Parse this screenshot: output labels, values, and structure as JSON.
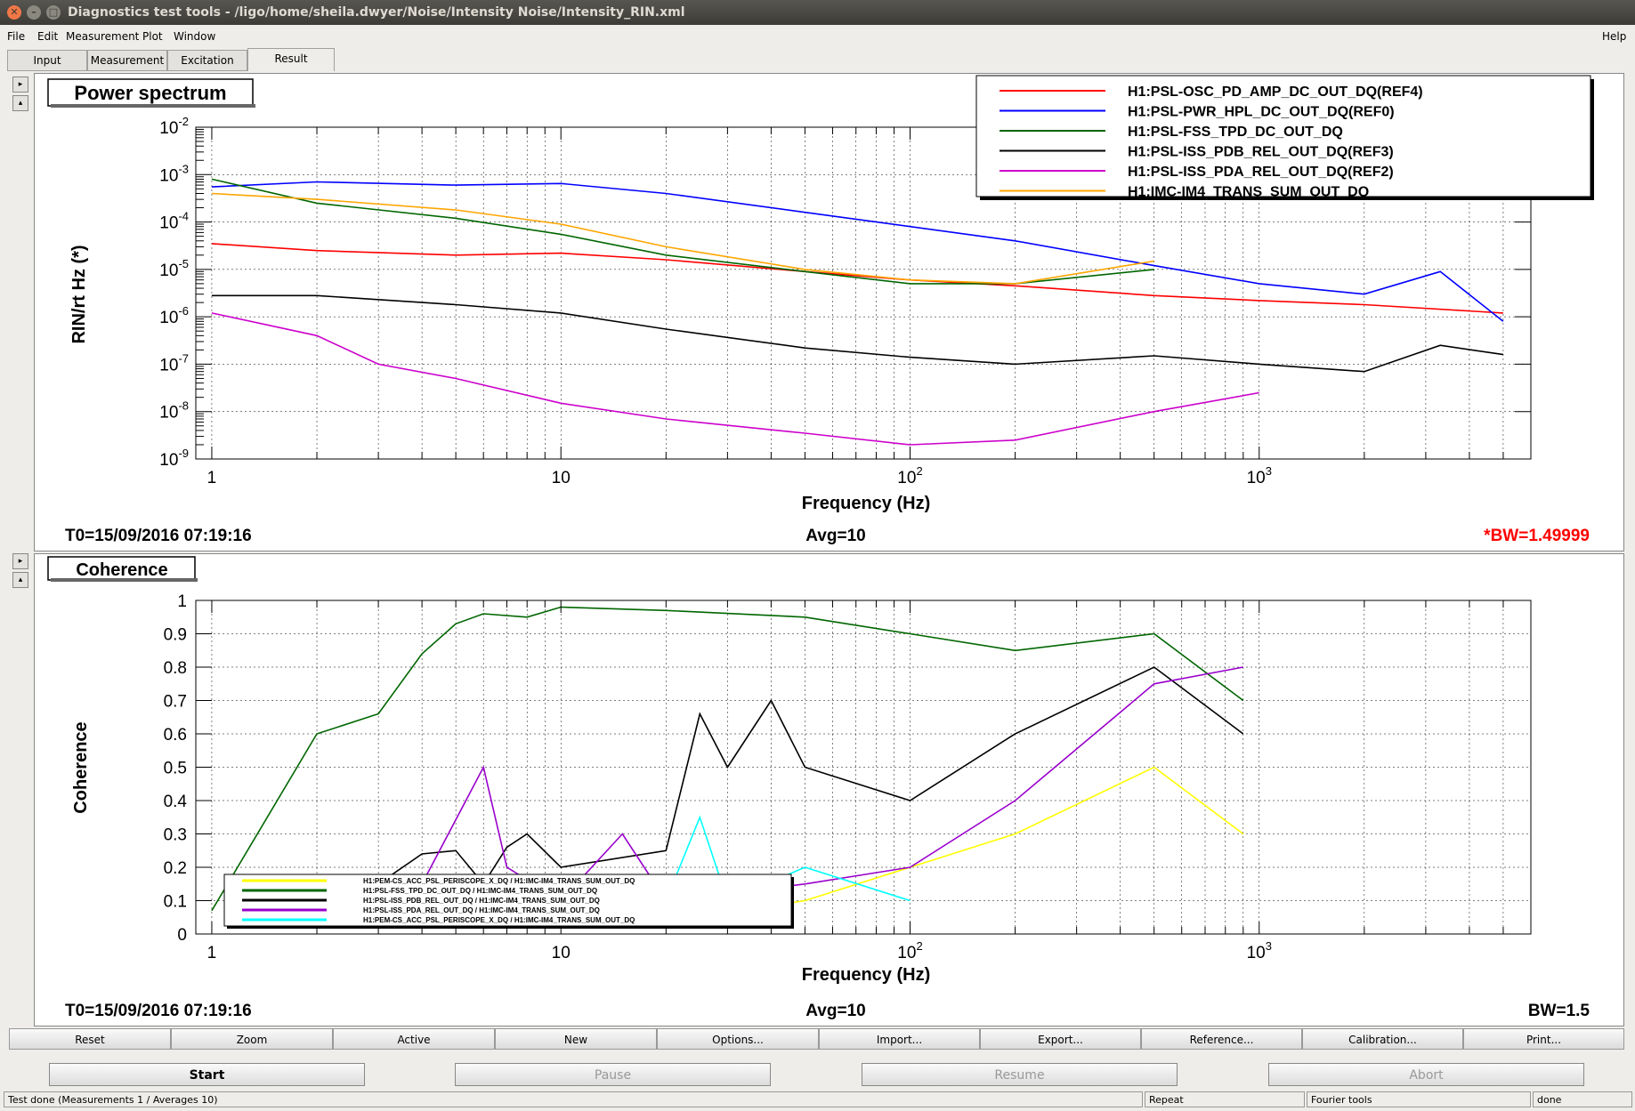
{
  "window": {
    "title": "Diagnostics test tools - /ligo/home/sheila.dwyer/Noise/Intensity Noise/Intensity_RIN.xml"
  },
  "menu": {
    "file": "File",
    "edit": "Edit",
    "measurement": "Measurement",
    "plot": "Plot",
    "window": "Window",
    "help": "Help"
  },
  "tabs": [
    "Input",
    "Measurement",
    "Excitation",
    "Result"
  ],
  "plot1": {
    "title": "Power spectrum",
    "ylabel": "RIN/rt Hz (*)",
    "xlabel": "Frequency (Hz)",
    "t0": "T0=15/09/2016 07:19:16",
    "avg": "Avg=10",
    "bw": "*BW=1.49999",
    "legend": [
      {
        "name": "H1:PSL-OSC_PD_AMP_DC_OUT_DQ(REF4)",
        "color": "#ff0000"
      },
      {
        "name": "H1:PSL-PWR_HPL_DC_OUT_DQ(REF0)",
        "color": "#0000ff"
      },
      {
        "name": "H1:PSL-FSS_TPD_DC_OUT_DQ",
        "color": "#006600"
      },
      {
        "name": "H1:PSL-ISS_PDB_REL_OUT_DQ(REF3)",
        "color": "#000000"
      },
      {
        "name": "H1:PSL-ISS_PDA_REL_OUT_DQ(REF2)",
        "color": "#cc00cc"
      },
      {
        "name": "H1:IMC-IM4_TRANS_SUM_OUT_DQ",
        "color": "#ffa500"
      }
    ]
  },
  "plot2": {
    "title": "Coherence",
    "ylabel": "Coherence",
    "xlabel": "Frequency (Hz)",
    "t0": "T0=15/09/2016 07:19:16",
    "avg": "Avg=10",
    "bw": "BW=1.5",
    "legend": [
      {
        "name": "H1:PEM-CS_ACC_PSL_PERISCOPE_X_DQ / H1:IMC-IM4_TRANS_SUM_OUT_DQ",
        "color": "#ffff00"
      },
      {
        "name": "H1:PSL-FSS_TPD_DC_OUT_DQ / H1:IMC-IM4_TRANS_SUM_OUT_DQ",
        "color": "#006600"
      },
      {
        "name": "H1:PSL-ISS_PDB_REL_OUT_DQ / H1:IMC-IM4_TRANS_SUM_OUT_DQ",
        "color": "#000000"
      },
      {
        "name": "H1:PSL-ISS_PDA_REL_OUT_DQ / H1:IMC-IM4_TRANS_SUM_OUT_DQ",
        "color": "#9900cc"
      },
      {
        "name": "H1:PEM-CS_ACC_PSL_PERISCOPE_X_DQ / H1:IMC-IM4_TRANS_SUM_OUT_DQ",
        "color": "#00ffff"
      }
    ]
  },
  "chart_data": [
    {
      "type": "line",
      "title": "Power spectrum",
      "xlabel": "Frequency (Hz)",
      "ylabel": "RIN/rt Hz (*)",
      "xscale": "log",
      "yscale": "log",
      "xlim": [
        0.9,
        6000
      ],
      "ylim": [
        1e-09,
        0.01
      ],
      "grid": true,
      "legend_position": "top-right",
      "series": [
        {
          "name": "H1:PSL-OSC_PD_AMP_DC_OUT_DQ(REF4)",
          "x": [
            1,
            2,
            5,
            10,
            20,
            50,
            100,
            200,
            500,
            1000,
            2000,
            5000
          ],
          "y": [
            3.5e-05,
            2.5e-05,
            2e-05,
            2.2e-05,
            1.6e-05,
            9e-06,
            6e-06,
            4.5e-06,
            2.8e-06,
            2.2e-06,
            1.8e-06,
            1.2e-06
          ]
        },
        {
          "name": "H1:PSL-PWR_HPL_DC_OUT_DQ(REF0)",
          "x": [
            1,
            2,
            5,
            10,
            20,
            50,
            100,
            200,
            500,
            1000,
            2000,
            3300,
            5000
          ],
          "y": [
            0.00055,
            0.0007,
            0.0006,
            0.00065,
            0.0004,
            0.00016,
            8e-05,
            4e-05,
            1.2e-05,
            5e-06,
            3e-06,
            9e-06,
            8e-07
          ]
        },
        {
          "name": "H1:PSL-FSS_TPD_DC_OUT_DQ",
          "x": [
            1,
            2,
            5,
            10,
            20,
            50,
            100,
            200,
            500
          ],
          "y": [
            0.0008,
            0.00025,
            0.00012,
            5.5e-05,
            2e-05,
            9e-06,
            5e-06,
            5e-06,
            1e-05
          ]
        },
        {
          "name": "H1:PSL-ISS_PDB_REL_OUT_DQ(REF3)",
          "x": [
            1,
            2,
            5,
            10,
            20,
            50,
            100,
            200,
            500,
            1000,
            2000,
            3300,
            5000
          ],
          "y": [
            2.8e-06,
            2.8e-06,
            1.8e-06,
            1.2e-06,
            5.5e-07,
            2.2e-07,
            1.4e-07,
            1e-07,
            1.5e-07,
            1e-07,
            7e-08,
            2.5e-07,
            1.6e-07
          ]
        },
        {
          "name": "H1:PSL-ISS_PDA_REL_OUT_DQ(REF2)",
          "x": [
            1,
            2,
            3,
            5,
            10,
            20,
            50,
            100,
            200,
            500,
            1000
          ],
          "y": [
            1.2e-06,
            4e-07,
            1e-07,
            5e-08,
            1.5e-08,
            7e-09,
            3.5e-09,
            2e-09,
            2.5e-09,
            1e-08,
            2.5e-08
          ]
        },
        {
          "name": "H1:IMC-IM4_TRANS_SUM_OUT_DQ",
          "x": [
            1,
            2,
            5,
            10,
            20,
            50,
            100,
            200,
            500
          ],
          "y": [
            0.0004,
            0.0003,
            0.00018,
            9e-05,
            3e-05,
            1e-05,
            6e-06,
            5e-06,
            1.5e-05
          ]
        }
      ]
    },
    {
      "type": "line",
      "title": "Coherence",
      "xlabel": "Frequency (Hz)",
      "ylabel": "Coherence",
      "xscale": "log",
      "xlim": [
        0.9,
        6000
      ],
      "ylim": [
        0,
        1
      ],
      "grid": true,
      "legend_position": "bottom-left",
      "series": [
        {
          "name": "H1:PEM-CS_ACC_PSL_PERISCOPE_X_DQ / H1:IMC-IM4_TRANS_SUM_OUT_DQ",
          "x": [
            25,
            50,
            100,
            200,
            500,
            900
          ],
          "y": [
            0.05,
            0.1,
            0.2,
            0.3,
            0.5,
            0.3
          ]
        },
        {
          "name": "H1:PSL-FSS_TPD_DC_OUT_DQ / H1:IMC-IM4_TRANS_SUM_OUT_DQ",
          "x": [
            1,
            2,
            3,
            4,
            5,
            6,
            8,
            10,
            20,
            50,
            100,
            200,
            500,
            900
          ],
          "y": [
            0.07,
            0.6,
            0.66,
            0.84,
            0.93,
            0.96,
            0.95,
            0.98,
            0.97,
            0.95,
            0.9,
            0.85,
            0.9,
            0.7
          ]
        },
        {
          "name": "H1:PSL-ISS_PDB_REL_OUT_DQ / H1:IMC-IM4_TRANS_SUM_OUT_DQ",
          "x": [
            3,
            4,
            5,
            6,
            7,
            8,
            10,
            20,
            25,
            30,
            40,
            50,
            100,
            200,
            500,
            900
          ],
          "y": [
            0.15,
            0.24,
            0.25,
            0.15,
            0.26,
            0.3,
            0.2,
            0.25,
            0.66,
            0.5,
            0.7,
            0.5,
            0.4,
            0.6,
            0.8,
            0.6
          ]
        },
        {
          "name": "H1:PSL-ISS_PDA_REL_OUT_DQ / H1:IMC-IM4_TRANS_SUM_OUT_DQ",
          "x": [
            4,
            6,
            7,
            10,
            15,
            20,
            50,
            100,
            200,
            500,
            900
          ],
          "y": [
            0.15,
            0.5,
            0.2,
            0.1,
            0.3,
            0.1,
            0.15,
            0.2,
            0.4,
            0.75,
            0.8
          ]
        },
        {
          "name": "H1:PEM-CS_ACC_PSL_PERISCOPE_X_DQ / H1:IMC-IM4_TRANS_SUM_OUT_DQ",
          "x": [
            20,
            25,
            30,
            50,
            100
          ],
          "y": [
            0.1,
            0.35,
            0.1,
            0.2,
            0.1
          ]
        }
      ]
    }
  ],
  "buttons": [
    "Reset",
    "Zoom",
    "Active",
    "New",
    "Options...",
    "Import...",
    "Export...",
    "Reference...",
    "Calibration...",
    "Print..."
  ],
  "controls": {
    "start": "Start",
    "pause": "Pause",
    "resume": "Resume",
    "abort": "Abort"
  },
  "status": {
    "main": "Test done (Measurements 1 / Averages 10)",
    "repeat": "Repeat",
    "tools": "Fourier tools",
    "state": "done"
  }
}
